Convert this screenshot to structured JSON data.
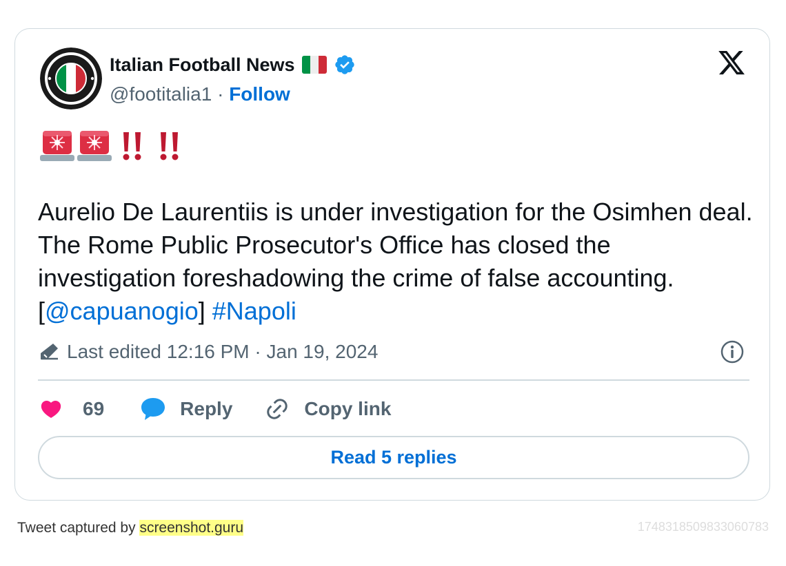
{
  "author": {
    "name": "Italian Football News",
    "handle": "@footitalia1",
    "separator": "·",
    "follow_label": "Follow",
    "verified": true,
    "flag_icon": "italy-flag-icon",
    "avatar_icon": "italy-flag-badge-avatar"
  },
  "tweet": {
    "emoji_icons": [
      "police-light-icon",
      "police-light-icon",
      "double-exclamation-icon",
      "double-exclamation-icon"
    ],
    "text_parts": {
      "line": "Aurelio De Laurentiis is under investigation for the Osimhen deal. The Rome Public Prosecutor's Office has closed the investigation foreshadowing the crime of false accounting. [",
      "mention": "@capuanogio",
      "close_bracket": "] ",
      "hashtag": "#Napoli"
    },
    "edited_label": "Last edited 12:16 PM · Jan 19, 2024"
  },
  "actions": {
    "likes": "69",
    "reply_label": "Reply",
    "copy_label": "Copy link"
  },
  "read_replies_label": "Read 5 replies",
  "footer": {
    "captured_prefix": "Tweet captured by ",
    "brand": "screenshot.guru",
    "tweet_id": "1748318509833060783"
  },
  "colors": {
    "link": "#006fd6",
    "like": "#f91880",
    "reply_bubble": "#1d9bf0",
    "muted": "#536471",
    "border": "#cfd9de",
    "highlight": "#ffff88"
  }
}
